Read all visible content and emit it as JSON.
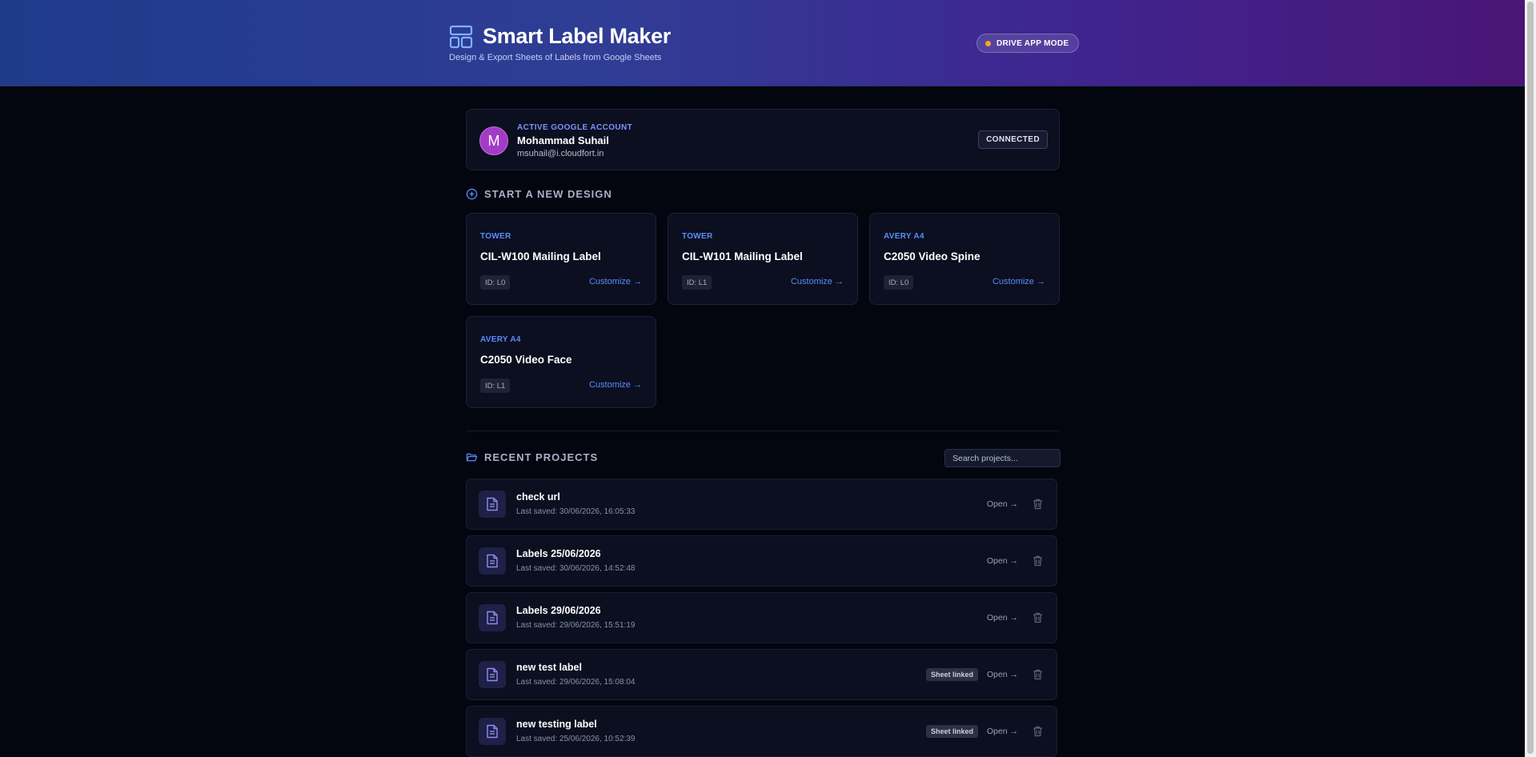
{
  "header": {
    "title": "Smart Label Maker",
    "subtitle": "Design & Export Sheets of Labels from Google Sheets",
    "mode_badge": "DRIVE APP MODE",
    "colors": {
      "mode_dot": "#f5a524",
      "accent": "#5b8cff"
    }
  },
  "account": {
    "label": "ACTIVE GOOGLE ACCOUNT",
    "avatar_initial": "M",
    "name": "Mohammad Suhail",
    "email": "msuhail@i.cloudfort.in",
    "status": "CONNECTED"
  },
  "new_design": {
    "heading": "START A NEW DESIGN",
    "templates": [
      {
        "brand": "TOWER",
        "name": "CIL-W100 Mailing Label",
        "id": "ID: L0",
        "action": "Customize →"
      },
      {
        "brand": "TOWER",
        "name": "CIL-W101 Mailing Label",
        "id": "ID: L1",
        "action": "Customize →"
      },
      {
        "brand": "AVERY A4",
        "name": "C2050 Video Spine",
        "id": "ID: L0",
        "action": "Customize →"
      },
      {
        "brand": "AVERY A4",
        "name": "C2050 Video Face",
        "id": "ID: L1",
        "action": "Customize →"
      }
    ]
  },
  "recent": {
    "heading": "RECENT PROJECTS",
    "search_placeholder": "Search projects...",
    "projects": [
      {
        "name": "check url",
        "saved": "Last saved: 30/06/2026, 16:05:33",
        "badge": "",
        "open": "Open →"
      },
      {
        "name": "Labels 25/06/2026",
        "saved": "Last saved: 30/06/2026, 14:52:48",
        "badge": "",
        "open": "Open →"
      },
      {
        "name": "Labels 29/06/2026",
        "saved": "Last saved: 29/06/2026, 15:51:19",
        "badge": "",
        "open": "Open →"
      },
      {
        "name": "new test label",
        "saved": "Last saved: 29/06/2026, 15:08:04",
        "badge": "Sheet linked",
        "open": "Open →"
      },
      {
        "name": "new testing label",
        "saved": "Last saved: 25/06/2026, 10:52:39",
        "badge": "Sheet linked",
        "open": "Open →"
      }
    ]
  }
}
